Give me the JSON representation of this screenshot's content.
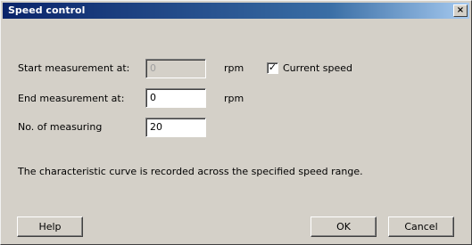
{
  "window": {
    "title": "Speed control",
    "close_glyph": "×"
  },
  "form": {
    "start_label": "Start measurement at:",
    "start_value": "0",
    "start_unit": "rpm",
    "current_speed_label": "Current speed",
    "current_speed_checked": true,
    "end_label": "End measurement at:",
    "end_value": "0",
    "end_unit": "rpm",
    "count_label": "No. of measuring",
    "count_value": "20"
  },
  "message": "The characteristic curve is recorded across the specified speed range.",
  "buttons": {
    "help": "Help",
    "ok": "OK",
    "cancel": "Cancel"
  },
  "colors": {
    "title_bar": "#0a246a",
    "dialog_bg": "#d4d0c8"
  }
}
